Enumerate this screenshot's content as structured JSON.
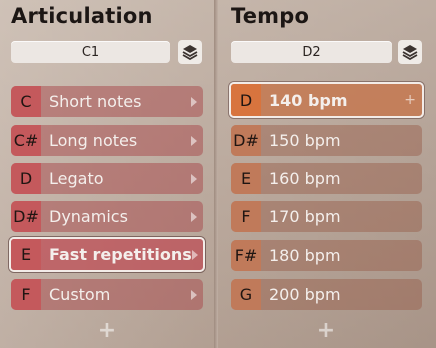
{
  "articulation": {
    "title": "Articulation",
    "selector_value": "C1",
    "layers_icon": "layers-icon",
    "items": [
      {
        "key": "C",
        "label": "Short notes",
        "selected": false
      },
      {
        "key": "C#",
        "label": "Long notes",
        "selected": false
      },
      {
        "key": "D",
        "label": "Legato",
        "selected": false
      },
      {
        "key": "D#",
        "label": "Dynamics",
        "selected": false
      },
      {
        "key": "E",
        "label": "Fast repetitions",
        "selected": true
      },
      {
        "key": "F",
        "label": "Custom",
        "selected": false
      }
    ],
    "add_label": "+"
  },
  "tempo": {
    "title": "Tempo",
    "selector_value": "D2",
    "layers_icon": "layers-icon",
    "items": [
      {
        "key": "D",
        "label": "140 bpm",
        "active": true
      },
      {
        "key": "D#",
        "label": "150 bpm",
        "active": false
      },
      {
        "key": "E",
        "label": "160 bpm",
        "active": false
      },
      {
        "key": "F",
        "label": "170 bpm",
        "active": false
      },
      {
        "key": "F#",
        "label": "180 bpm",
        "active": false
      },
      {
        "key": "G",
        "label": "200 bpm",
        "active": false
      }
    ],
    "add_label": "+",
    "active_plus": "+"
  },
  "colors": {
    "articulation_key": "#c4595c",
    "tempo_key": "#c07a5a",
    "tempo_active_key": "#d8743e"
  }
}
